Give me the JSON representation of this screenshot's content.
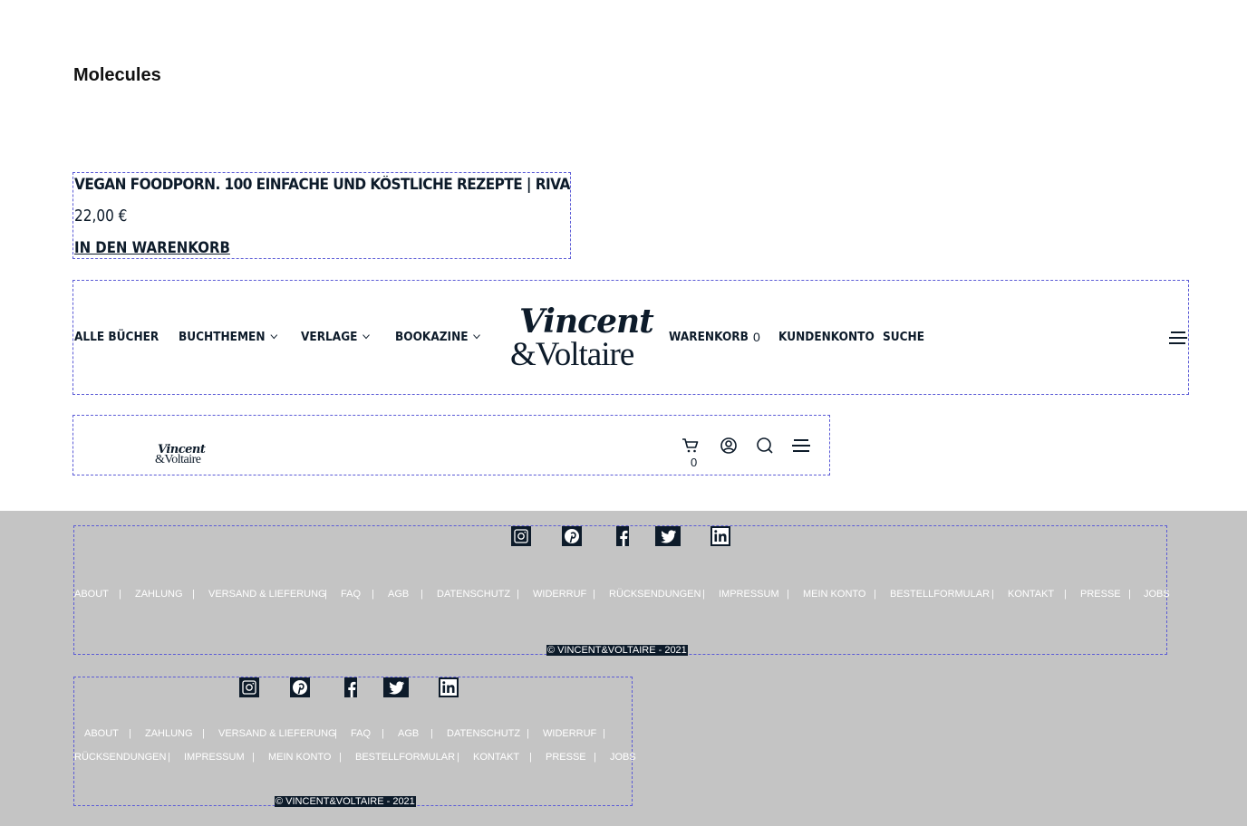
{
  "page": {
    "title": "Molecules"
  },
  "product": {
    "title": "VEGAN FOODPORN. 100 EINFACHE UND KÖSTLICHE REZEPTE | RIVA",
    "price": "22,00 €",
    "add_to_cart": "IN DEN WARENKORB"
  },
  "header": {
    "nav": [
      {
        "label": "ALLE BÜCHER",
        "has_dropdown": false
      },
      {
        "label": "BUCHTHEMEN",
        "has_dropdown": true
      },
      {
        "label": "VERLAGE",
        "has_dropdown": true
      },
      {
        "label": "BOOKAZINE",
        "has_dropdown": true
      }
    ],
    "logo": {
      "line1": "Vincent",
      "line2": "&Voltaire"
    },
    "right_nav": {
      "cart": "WARENKORB",
      "cart_count": "0",
      "account": "KUNDENKONTO",
      "search": "SUCHE"
    },
    "menu_icon": "hamburger-icon"
  },
  "mobile_header": {
    "logo": {
      "line1": "Vincent",
      "line2": "&Voltaire"
    },
    "icons": [
      "cart-icon",
      "account-icon",
      "search-icon",
      "hamburger-icon"
    ],
    "cart_count": "0"
  },
  "footer": {
    "background": "#c4c4c4",
    "social": [
      "instagram-icon",
      "pinterest-icon",
      "facebook-icon",
      "twitter-icon",
      "linkedin-icon"
    ],
    "links": [
      "ABOUT",
      "ZAHLUNG",
      "VERSAND & LIEFERUNG",
      "FAQ",
      "AGB",
      "DATENSCHUTZ",
      "WIDERRUF",
      "RÜCKSENDUNGEN",
      "IMPRESSUM",
      "MEIN KONTO",
      "BESTELLFORMULAR",
      "KONTAKT",
      "PRESSE",
      "JOBS"
    ],
    "separator": "|",
    "copyright": "© VINCENT&VOLTAIRE - 2021"
  },
  "colors": {
    "navy": "#0d1b2a",
    "footer_gray": "#c4c4c4",
    "dashed_outline": "#5b5bd6"
  }
}
